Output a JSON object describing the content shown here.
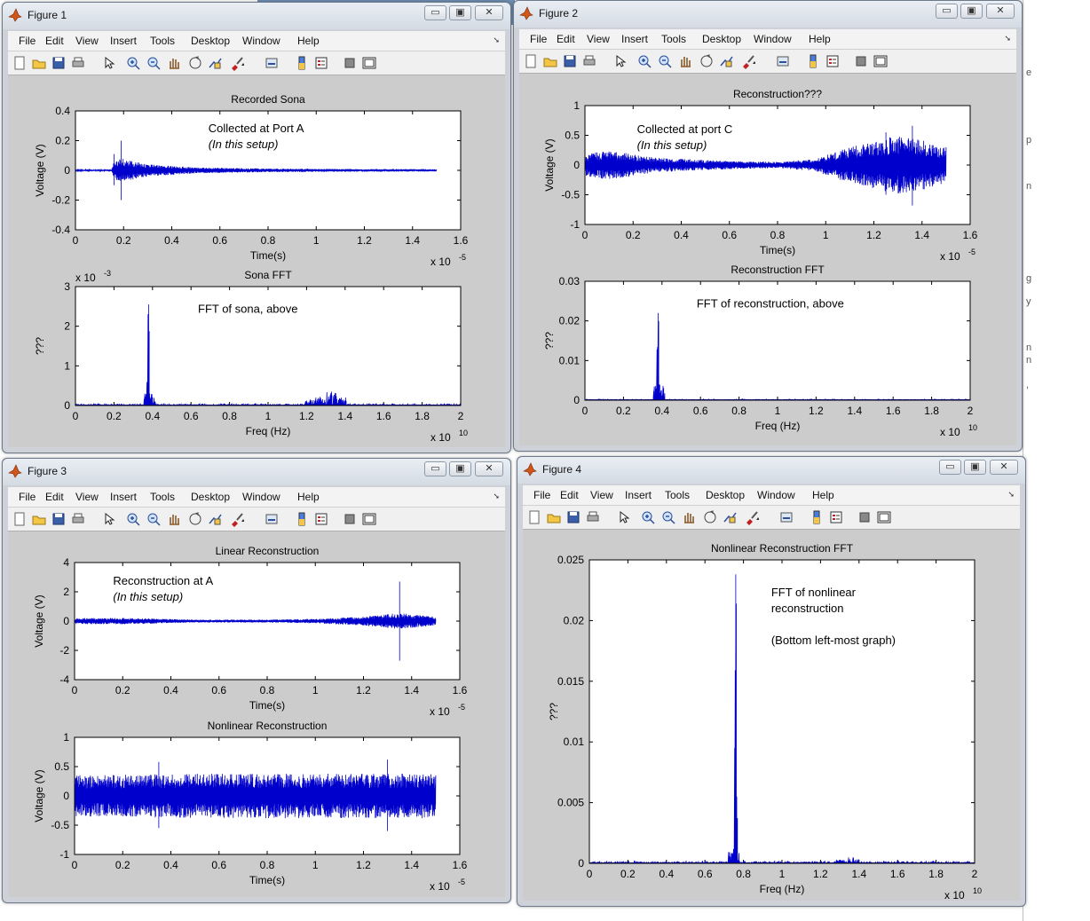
{
  "desktop": {
    "side_text": [
      "e",
      "p",
      "n",
      "g",
      "y",
      "n",
      "n",
      ","
    ]
  },
  "menus": [
    "File",
    "Edit",
    "View",
    "Insert",
    "Tools",
    "Desktop",
    "Window",
    "Help"
  ],
  "toolbar_icons": [
    "new-figure-icon",
    "open-file-icon",
    "save-icon",
    "print-icon",
    "pointer-icon",
    "zoom-in-icon",
    "zoom-out-icon",
    "pan-icon",
    "rotate-icon",
    "data-cursor-icon",
    "brush-icon",
    "link-icon",
    "colorbar-icon",
    "legend-icon",
    "hide-plot-tools-icon",
    "show-plot-tools-icon"
  ],
  "colors": {
    "trace": "#0000cc",
    "figure_bg": "#cccccc",
    "axes_bg": "#ffffff",
    "window_frame": "#ced2d8"
  },
  "windows": [
    {
      "title": "Figure 1",
      "chart_data": [
        {
          "type": "line",
          "title": "Recorded Sona",
          "xlabel": "Time(s)",
          "ylabel": "Voltage (V)",
          "xlim": [
            0,
            1.6
          ],
          "ylim": [
            -0.4,
            0.4
          ],
          "xticks": [
            "0",
            "0.2",
            "0.4",
            "0.6",
            "0.8",
            "1",
            "1.2",
            "1.4",
            "1.6"
          ],
          "yticks": [
            "0.4",
            "0.2",
            "0",
            "-0.2",
            "-0.4"
          ],
          "x_multiplier": "x 10",
          "x_exponent": "-5",
          "y_multiplier": "",
          "y_exponent": "",
          "annotation_lines": [
            "Collected at Port A",
            "(In this setup)"
          ],
          "signal": {
            "x_end": 1.5,
            "envelope": [
              [
                0,
                0.004
              ],
              [
                0.15,
                0.006
              ],
              [
                0.16,
                0.06
              ],
              [
                0.19,
                0.08
              ],
              [
                0.3,
                0.04
              ],
              [
                0.5,
                0.02
              ],
              [
                0.8,
                0.012
              ],
              [
                1.2,
                0.009
              ],
              [
                1.5,
                0.008
              ]
            ],
            "spikes": [
              [
                0.19,
                0.2,
                -0.2
              ],
              [
                0.16,
                0.11,
                -0.1
              ]
            ]
          }
        },
        {
          "type": "line",
          "title": "Sona FFT",
          "xlabel": "Freq (Hz)",
          "ylabel": "???",
          "xlim": [
            0,
            2
          ],
          "ylim": [
            0,
            3
          ],
          "xticks": [
            "0",
            "0.2",
            "0.4",
            "0.6",
            "0.8",
            "1",
            "1.2",
            "1.4",
            "1.6",
            "1.8",
            "2"
          ],
          "yticks": [
            "3",
            "2",
            "1",
            "0"
          ],
          "x_multiplier": "x 10",
          "x_exponent": "10",
          "y_multiplier": "x 10",
          "y_exponent": "-3",
          "annotation_lines": [
            "FFT of sona, above"
          ],
          "spectrum": {
            "noise": 0.06,
            "peaks": [
              [
                0.38,
                2.55
              ],
              [
                0.375,
                0.8
              ],
              [
                0.385,
                0.3
              ],
              [
                1.33,
                0.35
              ],
              [
                1.27,
                0.22
              ],
              [
                1.38,
                0.2
              ],
              [
                1.22,
                0.15
              ]
            ]
          }
        }
      ]
    },
    {
      "title": "Figure 2",
      "chart_data": [
        {
          "type": "line",
          "title": "Reconstruction???",
          "xlabel": "Time(s)",
          "ylabel": "Voltage (V)",
          "xlim": [
            0,
            1.6
          ],
          "ylim": [
            -1,
            1
          ],
          "xticks": [
            "0",
            "0.2",
            "0.4",
            "0.6",
            "0.8",
            "1",
            "1.2",
            "1.4",
            "1.6"
          ],
          "yticks": [
            "1",
            "0.5",
            "0",
            "-0.5",
            "-1"
          ],
          "x_multiplier": "x 10",
          "x_exponent": "-5",
          "y_multiplier": "",
          "y_exponent": "",
          "annotation_lines": [
            "Collected at port C",
            "(In this setup)"
          ],
          "signal": {
            "x_end": 1.5,
            "envelope": [
              [
                0,
                0.18
              ],
              [
                0.1,
                0.25
              ],
              [
                0.3,
                0.12
              ],
              [
                0.6,
                0.07
              ],
              [
                0.8,
                0.05
              ],
              [
                0.95,
                0.1
              ],
              [
                1.1,
                0.3
              ],
              [
                1.3,
                0.5
              ],
              [
                1.4,
                0.42
              ],
              [
                1.5,
                0.3
              ]
            ],
            "spikes": [
              [
                1.36,
                0.66,
                -0.68
              ],
              [
                1.25,
                0.55,
                -0.5
              ]
            ]
          }
        },
        {
          "type": "line",
          "title": "Reconstruction FFT",
          "xlabel": "Freq (Hz)",
          "ylabel": "???",
          "xlim": [
            0,
            2
          ],
          "ylim": [
            0,
            0.03
          ],
          "xticks": [
            "0",
            "0.2",
            "0.4",
            "0.6",
            "0.8",
            "1",
            "1.2",
            "1.4",
            "1.6",
            "1.8",
            "2"
          ],
          "yticks": [
            "0.03",
            "0.02",
            "0.01",
            "0"
          ],
          "x_multiplier": "x 10",
          "x_exponent": "10",
          "y_multiplier": "",
          "y_exponent": "",
          "annotation_lines": [
            "FFT of reconstruction, above"
          ],
          "spectrum": {
            "noise": 0.0003,
            "peaks": [
              [
                0.38,
                0.022
              ],
              [
                0.377,
                0.013
              ],
              [
                0.385,
                0.004
              ]
            ]
          }
        }
      ]
    },
    {
      "title": "Figure 3",
      "chart_data": [
        {
          "type": "line",
          "title": "Linear Reconstruction",
          "xlabel": "Time(s)",
          "ylabel": "Voltage (V)",
          "xlim": [
            0,
            1.6
          ],
          "ylim": [
            -4,
            4
          ],
          "xticks": [
            "0",
            "0.2",
            "0.4",
            "0.6",
            "0.8",
            "1",
            "1.2",
            "1.4",
            "1.6"
          ],
          "yticks": [
            "4",
            "2",
            "0",
            "-2",
            "-4"
          ],
          "x_multiplier": "x 10",
          "x_exponent": "-5",
          "y_multiplier": "",
          "y_exponent": "",
          "annotation_lines": [
            "Reconstruction at A",
            "(In this setup)"
          ],
          "signal": {
            "x_end": 1.5,
            "envelope": [
              [
                0,
                0.2
              ],
              [
                0.2,
                0.22
              ],
              [
                0.5,
                0.1
              ],
              [
                0.8,
                0.1
              ],
              [
                1.0,
                0.15
              ],
              [
                1.2,
                0.3
              ],
              [
                1.35,
                0.55
              ],
              [
                1.5,
                0.3
              ]
            ],
            "spikes": [
              [
                1.35,
                2.7,
                -2.7
              ]
            ]
          }
        },
        {
          "type": "line",
          "title": "Nonlinear Reconstruction",
          "xlabel": "Time(s)",
          "ylabel": "Voltage (V)",
          "xlim": [
            0,
            1.6
          ],
          "ylim": [
            -1,
            1
          ],
          "xticks": [
            "0",
            "0.2",
            "0.4",
            "0.6",
            "0.8",
            "1",
            "1.2",
            "1.4",
            "1.6"
          ],
          "yticks": [
            "1",
            "0.5",
            "0",
            "-0.5",
            "-1"
          ],
          "x_multiplier": "x 10",
          "x_exponent": "-5",
          "y_multiplier": "",
          "y_exponent": "",
          "annotation_lines": [],
          "signal": {
            "x_end": 1.5,
            "envelope": [
              [
                0,
                0.35
              ],
              [
                0.5,
                0.38
              ],
              [
                1.0,
                0.38
              ],
              [
                1.5,
                0.38
              ]
            ],
            "spikes": [
              [
                0.35,
                0.58,
                -0.55
              ],
              [
                1.3,
                0.62,
                -0.6
              ]
            ]
          }
        }
      ]
    },
    {
      "title": "Figure 4",
      "chart_data": [
        {
          "type": "line",
          "title": "Nonlinear Reconstruction FFT",
          "xlabel": "Freq (Hz)",
          "ylabel": "???",
          "xlim": [
            0,
            2
          ],
          "ylim": [
            0,
            0.025
          ],
          "xticks": [
            "0",
            "0.2",
            "0.4",
            "0.6",
            "0.8",
            "1",
            "1.2",
            "1.4",
            "1.6",
            "1.8",
            "2"
          ],
          "yticks": [
            "0.025",
            "0.02",
            "0.015",
            "0.01",
            "0.005",
            "0"
          ],
          "x_multiplier": "x 10",
          "x_exponent": "10",
          "y_multiplier": "",
          "y_exponent": "",
          "annotation_lines": [
            "FFT of nonlinear",
            "reconstruction",
            "",
            "(Bottom left-most graph)"
          ],
          "spectrum": {
            "noise": 0.00025,
            "peaks": [
              [
                0.76,
                0.0238
              ],
              [
                0.757,
                0.0105
              ],
              [
                0.765,
                0.0055
              ],
              [
                0.752,
                0.0012
              ],
              [
                1.37,
                0.0005
              ],
              [
                1.3,
                0.0003
              ]
            ]
          }
        }
      ]
    }
  ]
}
